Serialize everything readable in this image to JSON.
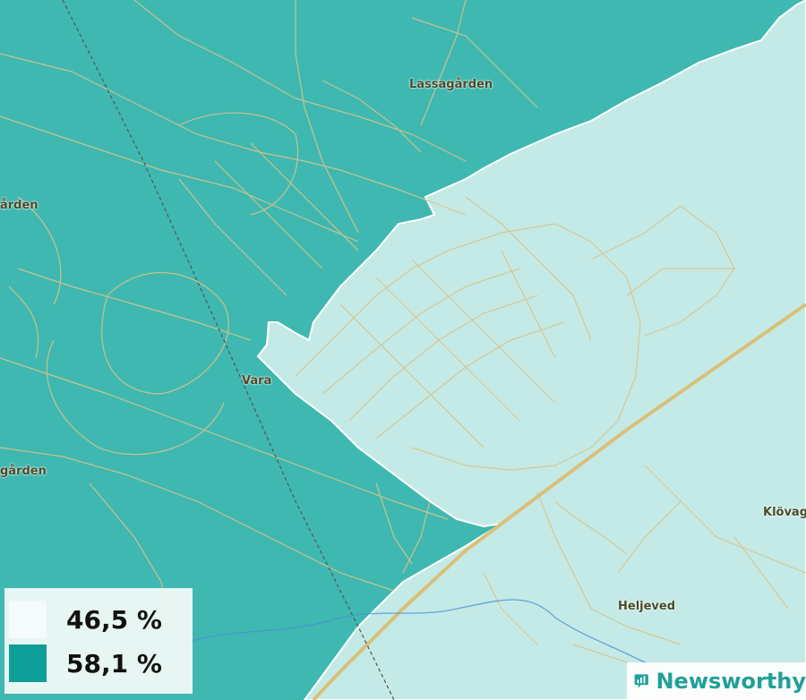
{
  "map": {
    "places": [
      {
        "id": "lassagarden",
        "label": "Lassagården"
      },
      {
        "id": "vara",
        "label": "Vara"
      },
      {
        "id": "arden-west",
        "label": "ården"
      },
      {
        "id": "garden-west",
        "label": "gården"
      },
      {
        "id": "heljeved",
        "label": "Heljeved"
      },
      {
        "id": "klovaga",
        "label": "Klövaga"
      }
    ],
    "colors": {
      "high_area": "#3fb8b1",
      "low_area": "#c4eae7",
      "roads": "#d8c48a",
      "highway": "#d9c07a",
      "railway": "#555555",
      "water": "#4a90d9"
    }
  },
  "legend": {
    "items": [
      {
        "label": "46,5 %",
        "color": "#f4fbfa"
      },
      {
        "label": "58,1 %",
        "color": "#0f9e97"
      }
    ]
  },
  "brand": {
    "name": "Newsworthy",
    "icon": "newsworthy-chart-bubble-icon",
    "color": "#20a09a"
  }
}
